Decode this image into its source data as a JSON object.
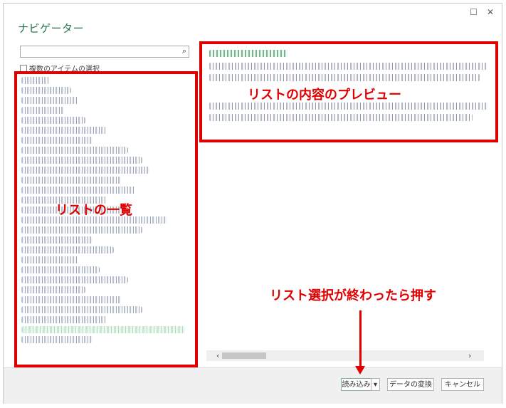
{
  "window": {
    "title": "ナビゲーター",
    "restore_glyph": "☐",
    "close_glyph": "✕"
  },
  "search": {
    "placeholder": "",
    "icon": "search-icon",
    "icon_glyph": "⌕"
  },
  "multi_select": {
    "label": "複数のアイテムの選択"
  },
  "scroll": {
    "left_glyph": "‹",
    "right_glyph": "›"
  },
  "buttons": {
    "load": "読み込み",
    "load_dropdown": "▾",
    "transform": "データの変換",
    "cancel": "キャンセル"
  },
  "annotations": {
    "list": "リストの一覧",
    "preview": "リストの内容のプレビュー",
    "press": "リスト選択が終わったら押す"
  },
  "colors": {
    "highlight": "#e00000",
    "title_green": "#217346"
  }
}
